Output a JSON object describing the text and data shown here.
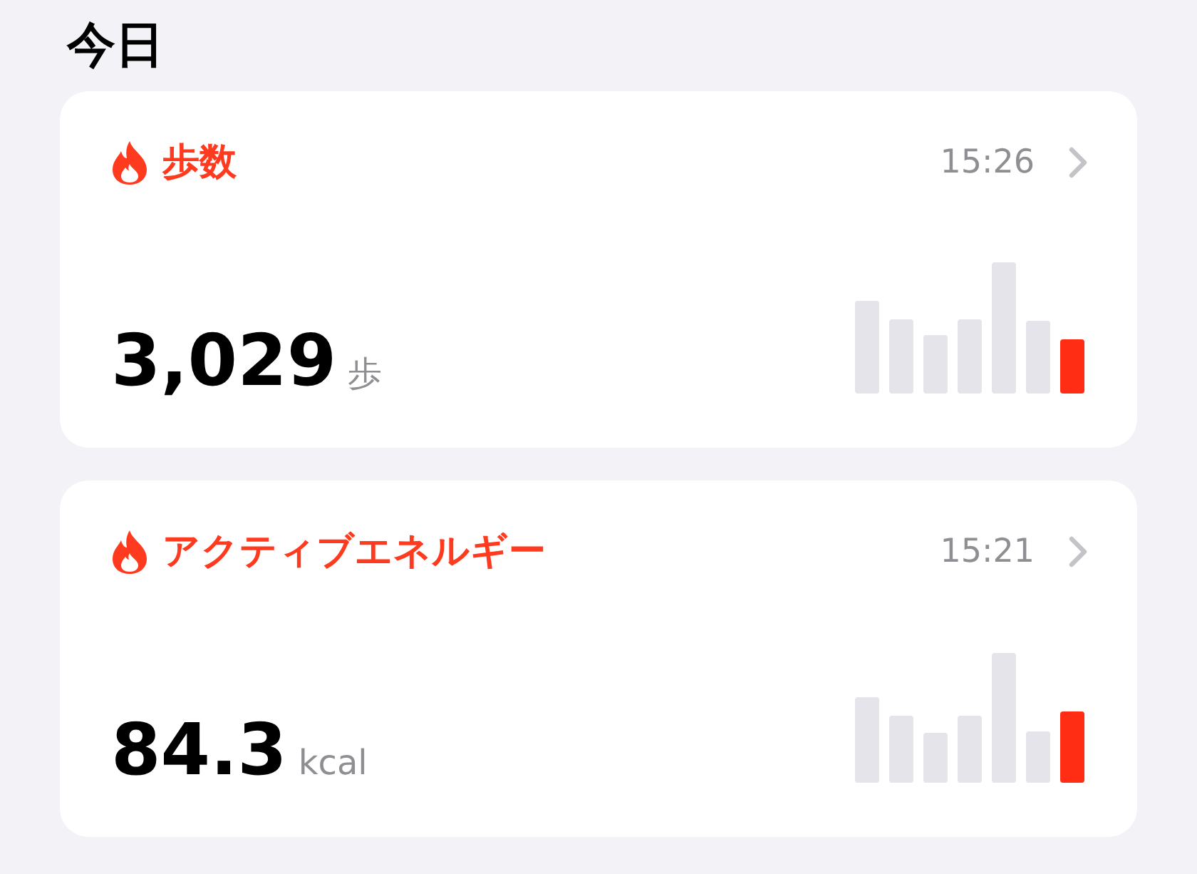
{
  "title": "今日",
  "cards": [
    {
      "label": "歩数",
      "time": "15:26",
      "value": "3,029",
      "unit": "歩"
    },
    {
      "label": "アクティブエネルギー",
      "time": "15:21",
      "value": "84.3",
      "unit": "kcal"
    }
  ]
}
